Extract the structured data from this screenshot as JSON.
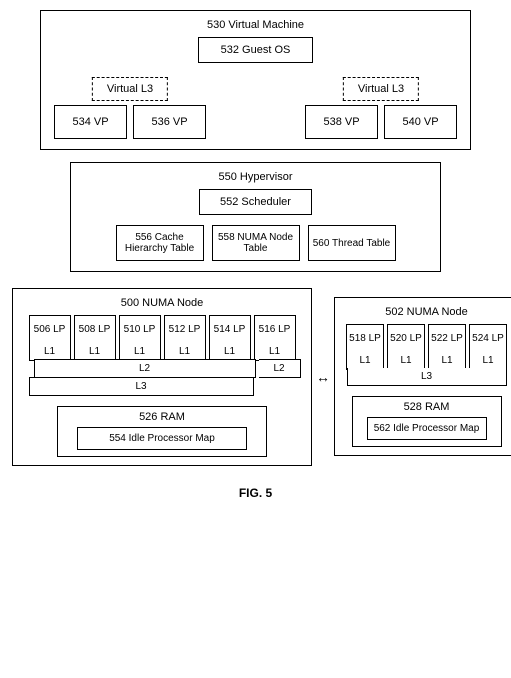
{
  "figure_label": "FIG. 5",
  "vm": {
    "title": "530 Virtual Machine",
    "guest_os": "532 Guest OS",
    "virtual_l3": "Virtual L3",
    "vps": [
      "534 VP",
      "536 VP",
      "538 VP",
      "540 VP"
    ]
  },
  "hypervisor": {
    "title": "550 Hypervisor",
    "scheduler": "552 Scheduler",
    "tables": [
      "556 Cache Hierarchy Table",
      "558 NUMA Node Table",
      "560 Thread Table"
    ]
  },
  "numa0": {
    "title": "500 NUMA Node",
    "lps": [
      "506 LP",
      "508 LP",
      "510 LP",
      "512 LP",
      "514 LP",
      "516 LP"
    ],
    "l1": "L1",
    "l2": "L2",
    "l3": "L3",
    "ram": "526 RAM",
    "ipm": "554 Idle Processor Map"
  },
  "numa1": {
    "title": "502 NUMA Node",
    "lps": [
      "518 LP",
      "520 LP",
      "522 LP",
      "524 LP"
    ],
    "l1": "L1",
    "l3": "L3",
    "ram": "528 RAM",
    "ipm": "562 Idle Processor Map"
  }
}
